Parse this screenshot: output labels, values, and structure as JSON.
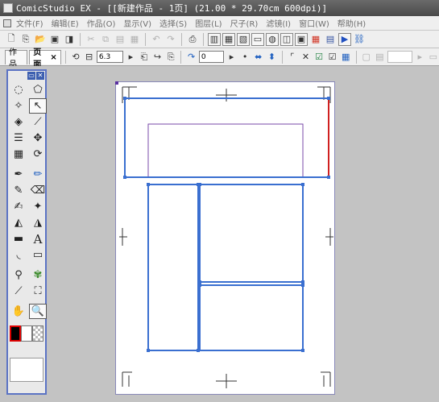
{
  "window": {
    "title": "ComicStudio EX - [[新建作品 - 1页] (21.00 * 29.70cm 600dpi)]"
  },
  "menu": [
    "文件(F)",
    "编辑(E)",
    "作品(O)",
    "显示(V)",
    "选择(S)",
    "图层(L)",
    "尺子(R)",
    "滤镜(I)",
    "窗口(W)",
    "帮助(H)"
  ],
  "toolbar": {
    "tab_works": "作品",
    "tab_page": "页面",
    "tab_close": "×",
    "field_a": "6.3",
    "field_b": "0"
  },
  "palette": {
    "tools": [
      "lasso-select-icon",
      "polygon-select-icon",
      "magic-wand-icon",
      "pointer-icon",
      "fill-select-icon",
      "eyedropper-icon",
      "layer-move-icon",
      "move-icon",
      "frame-ruler-icon",
      "rotate-icon",
      "pen-icon",
      "pencil-icon",
      "marker-icon",
      "eraser-icon",
      "brush-icon",
      "blur-icon",
      "fill-icon",
      "fill-alt-icon",
      "gradient-icon",
      "text-icon",
      "curve-icon",
      "rect-icon",
      "tone-icon",
      "tone-brush-icon",
      "pattern-brush-icon",
      "stamp-icon",
      "hand-icon",
      "zoom-icon"
    ],
    "text_tool_label": "A",
    "colors": {
      "main": "#000000",
      "sub": "#ffffff"
    }
  },
  "colors": {
    "frame_blue": "#3a6fd0",
    "selection_red": "#d02020",
    "guide_purple": "#7a4aa8"
  }
}
